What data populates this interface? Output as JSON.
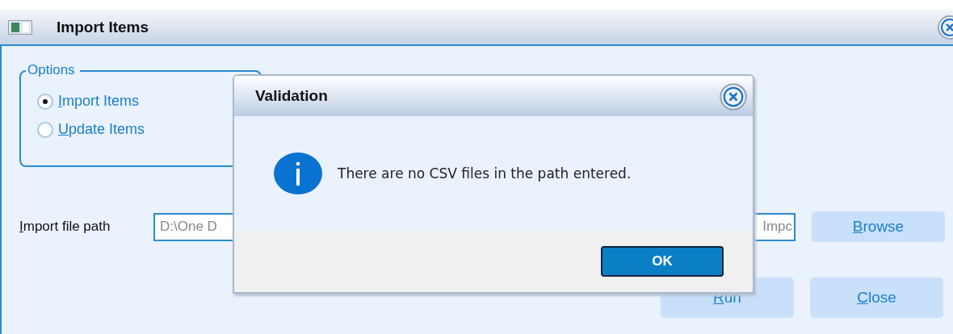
{
  "window": {
    "title": "Import Items"
  },
  "options": {
    "title": "Options",
    "items": [
      {
        "label": "Import Items",
        "selected": true
      },
      {
        "label": "Update Items",
        "selected": false
      }
    ]
  },
  "path": {
    "label": "Import file path",
    "value_start": "D:\\One D",
    "value_end": "Impc"
  },
  "buttons": [
    {
      "label": "Browse",
      "kind": "browse"
    },
    {
      "label": "Run",
      "kind": "run"
    },
    {
      "label": "Close",
      "kind": "close"
    }
  ],
  "dialog": {
    "title": "Validation",
    "message": "There are no CSV files in the path entered.",
    "button": "OK"
  }
}
